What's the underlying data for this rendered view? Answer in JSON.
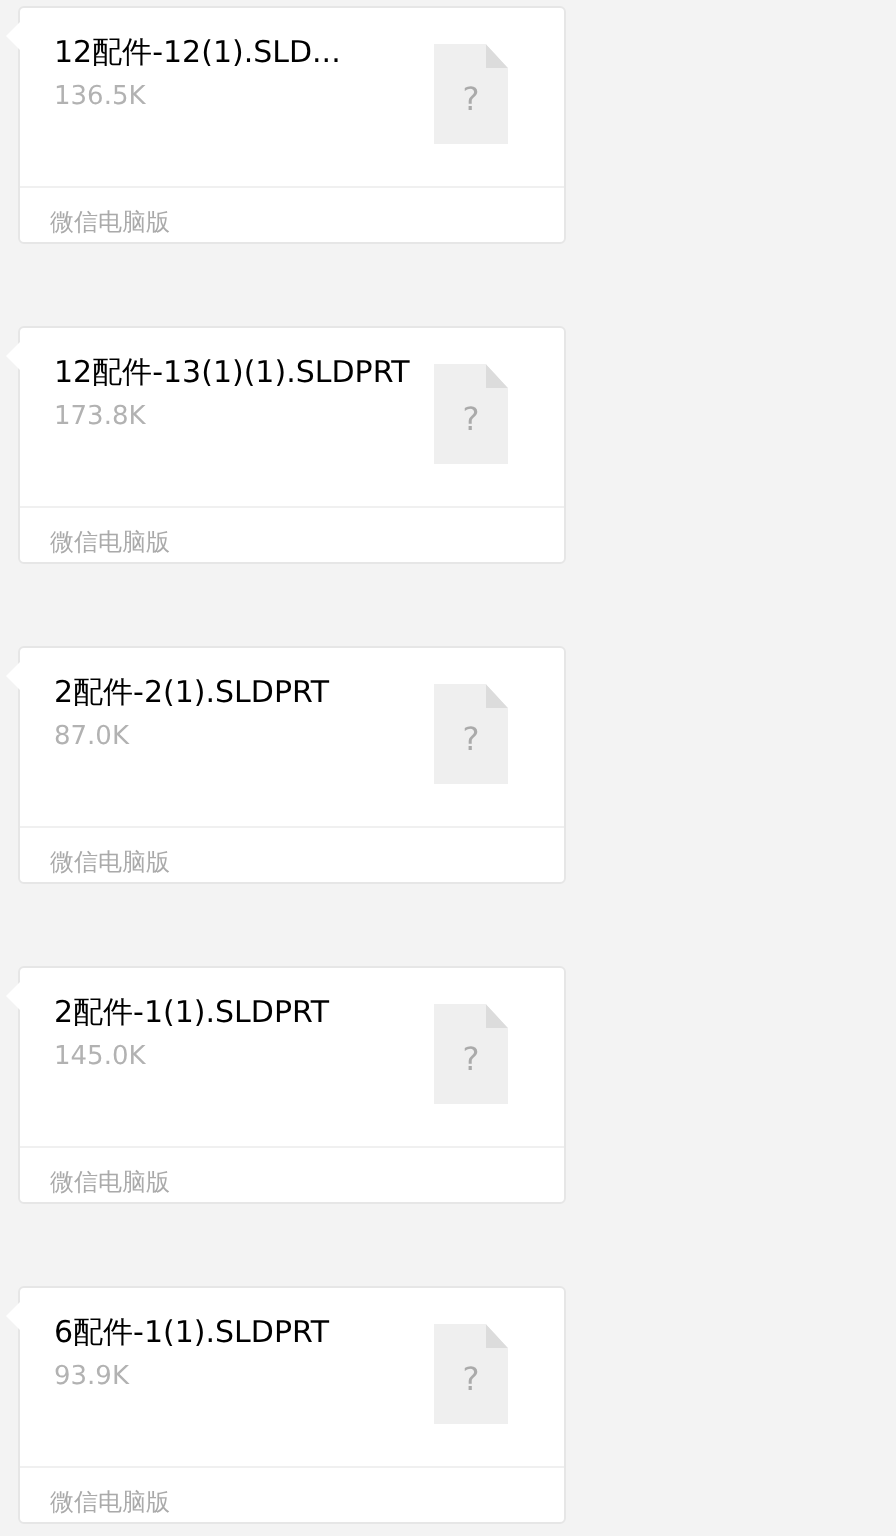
{
  "messages": [
    {
      "title": "12配件-12(1).SLD...",
      "size": "136.5K",
      "icon": "?",
      "source": "微信电脑版"
    },
    {
      "title": "12配件-13(1)(1).SLDPRT",
      "size": "173.8K",
      "icon": "?",
      "source": "微信电脑版"
    },
    {
      "title": "2配件-2(1).SLDPRT",
      "size": "87.0K",
      "icon": "?",
      "source": "微信电脑版"
    },
    {
      "title": "2配件-1(1).SLDPRT",
      "size": "145.0K",
      "icon": "?",
      "source": "微信电脑版"
    },
    {
      "title": "6配件-1(1).SLDPRT",
      "size": "93.9K",
      "icon": "?",
      "source": "微信电脑版"
    }
  ]
}
